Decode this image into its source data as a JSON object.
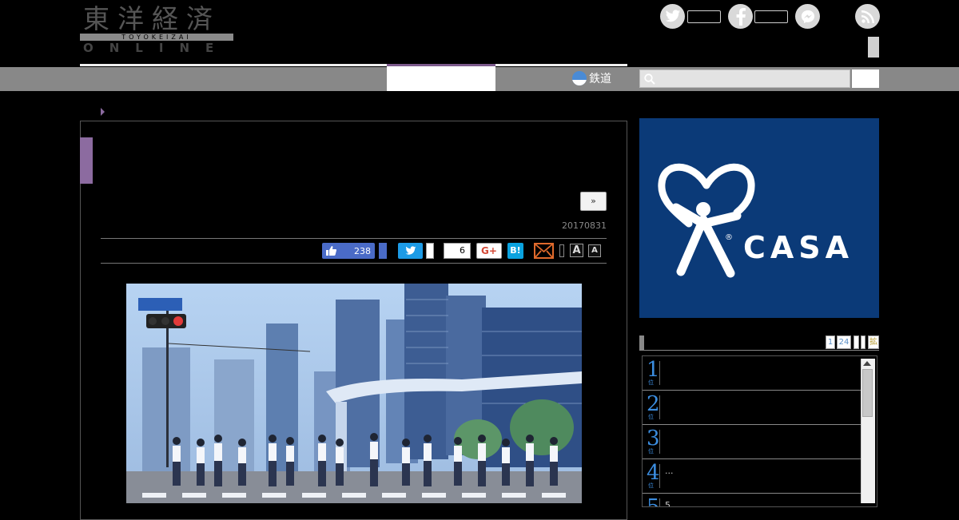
{
  "logo": {
    "kanji": "東洋経済",
    "romaji": "TOYOKEIZAI",
    "online": "ONLINE"
  },
  "header": {
    "social_icons": [
      "twitter-icon",
      "facebook-icon",
      "messenger-icon",
      "rss-icon"
    ]
  },
  "nav": {
    "rail_label": "鉄道",
    "search_placeholder": ""
  },
  "article": {
    "next_label": "»",
    "date": "20170831",
    "share": {
      "like_count": "238",
      "pocket_count": "6",
      "gplus_label": "G+",
      "hatena_label": "B!",
      "font_small": "A",
      "font_large": "A"
    }
  },
  "ad": {
    "brand": "CASA",
    "reg": "®"
  },
  "ranking": {
    "tabs": [
      "1",
      "24",
      "",
      "",
      "拡"
    ],
    "items": [
      {
        "rank": "1",
        "sub": "位",
        "text": ""
      },
      {
        "rank": "2",
        "sub": "位",
        "text": ""
      },
      {
        "rank": "3",
        "sub": "位",
        "text": ""
      },
      {
        "rank": "4",
        "sub": "位",
        "text": "..."
      },
      {
        "rank": "5",
        "sub": "位",
        "text": "5"
      }
    ]
  },
  "colors": {
    "accent_purple": "#8c6ba0",
    "nav_gray": "#888888",
    "ad_blue": "#0b3a78",
    "rank_blue": "#3b8de0",
    "twitter": "#1d9be6",
    "facebook": "#4a6bc7"
  }
}
